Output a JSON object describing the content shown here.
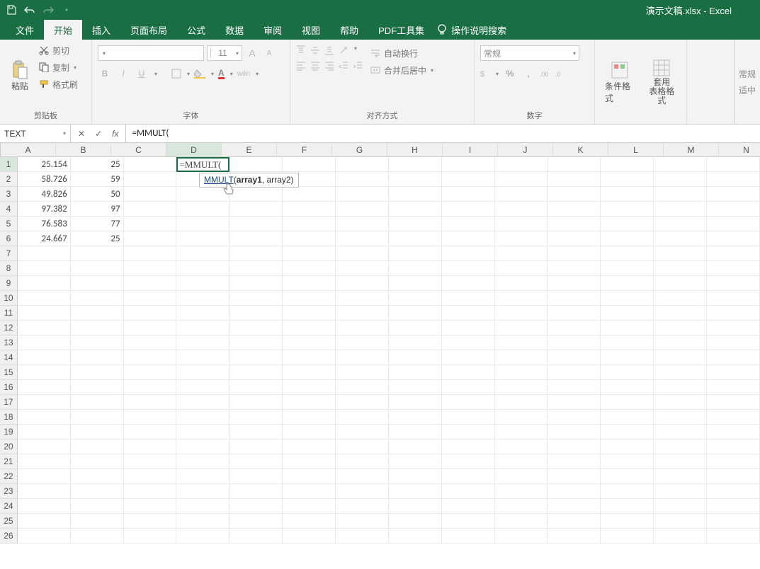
{
  "title": "演示文稿.xlsx  -  Excel",
  "tabs": {
    "file": "文件",
    "home": "开始",
    "insert": "插入",
    "layout": "页面布局",
    "formulas": "公式",
    "data": "数据",
    "review": "审阅",
    "view": "视图",
    "help": "帮助",
    "pdf": "PDF工具集",
    "search": "操作说明搜索"
  },
  "ribbon": {
    "clipboard": {
      "paste": "粘贴",
      "cut": "剪切",
      "copy": "复制",
      "painter": "格式刷",
      "label": "剪贴板"
    },
    "font": {
      "name": "",
      "size": "11",
      "bold": "B",
      "italic": "I",
      "underline": "U",
      "label": "字体",
      "larger": "A",
      "smaller": "A"
    },
    "align": {
      "wrap": "自动换行",
      "merge": "合并后居中",
      "label": "对齐方式"
    },
    "number": {
      "format": "常规",
      "percent": "%",
      "comma": ",",
      "label": "数字"
    },
    "styles": {
      "conditional": "条件格式",
      "table": "套用\n表格格式"
    },
    "right": {
      "normal": "常规",
      "mid": "适中"
    }
  },
  "formula_bar": {
    "name": "TEXT",
    "formula": "=MMULT("
  },
  "tooltip": {
    "fn": "MMULT",
    "args": "(array1, array2)"
  },
  "columns": [
    "A",
    "B",
    "C",
    "D",
    "E",
    "F",
    "G",
    "H",
    "I",
    "J",
    "K",
    "L",
    "M",
    "N"
  ],
  "active_cell": "D1",
  "cell_data": {
    "A1": "25.154",
    "B1": "25",
    "D1": "=MMULT(",
    "A2": "58.726",
    "B2": "59",
    "A3": "49.826",
    "B3": "50",
    "A4": "97.382",
    "B4": "97",
    "A5": "76.583",
    "B5": "77",
    "A6": "24.667",
    "B6": "25"
  },
  "row_count": 26
}
